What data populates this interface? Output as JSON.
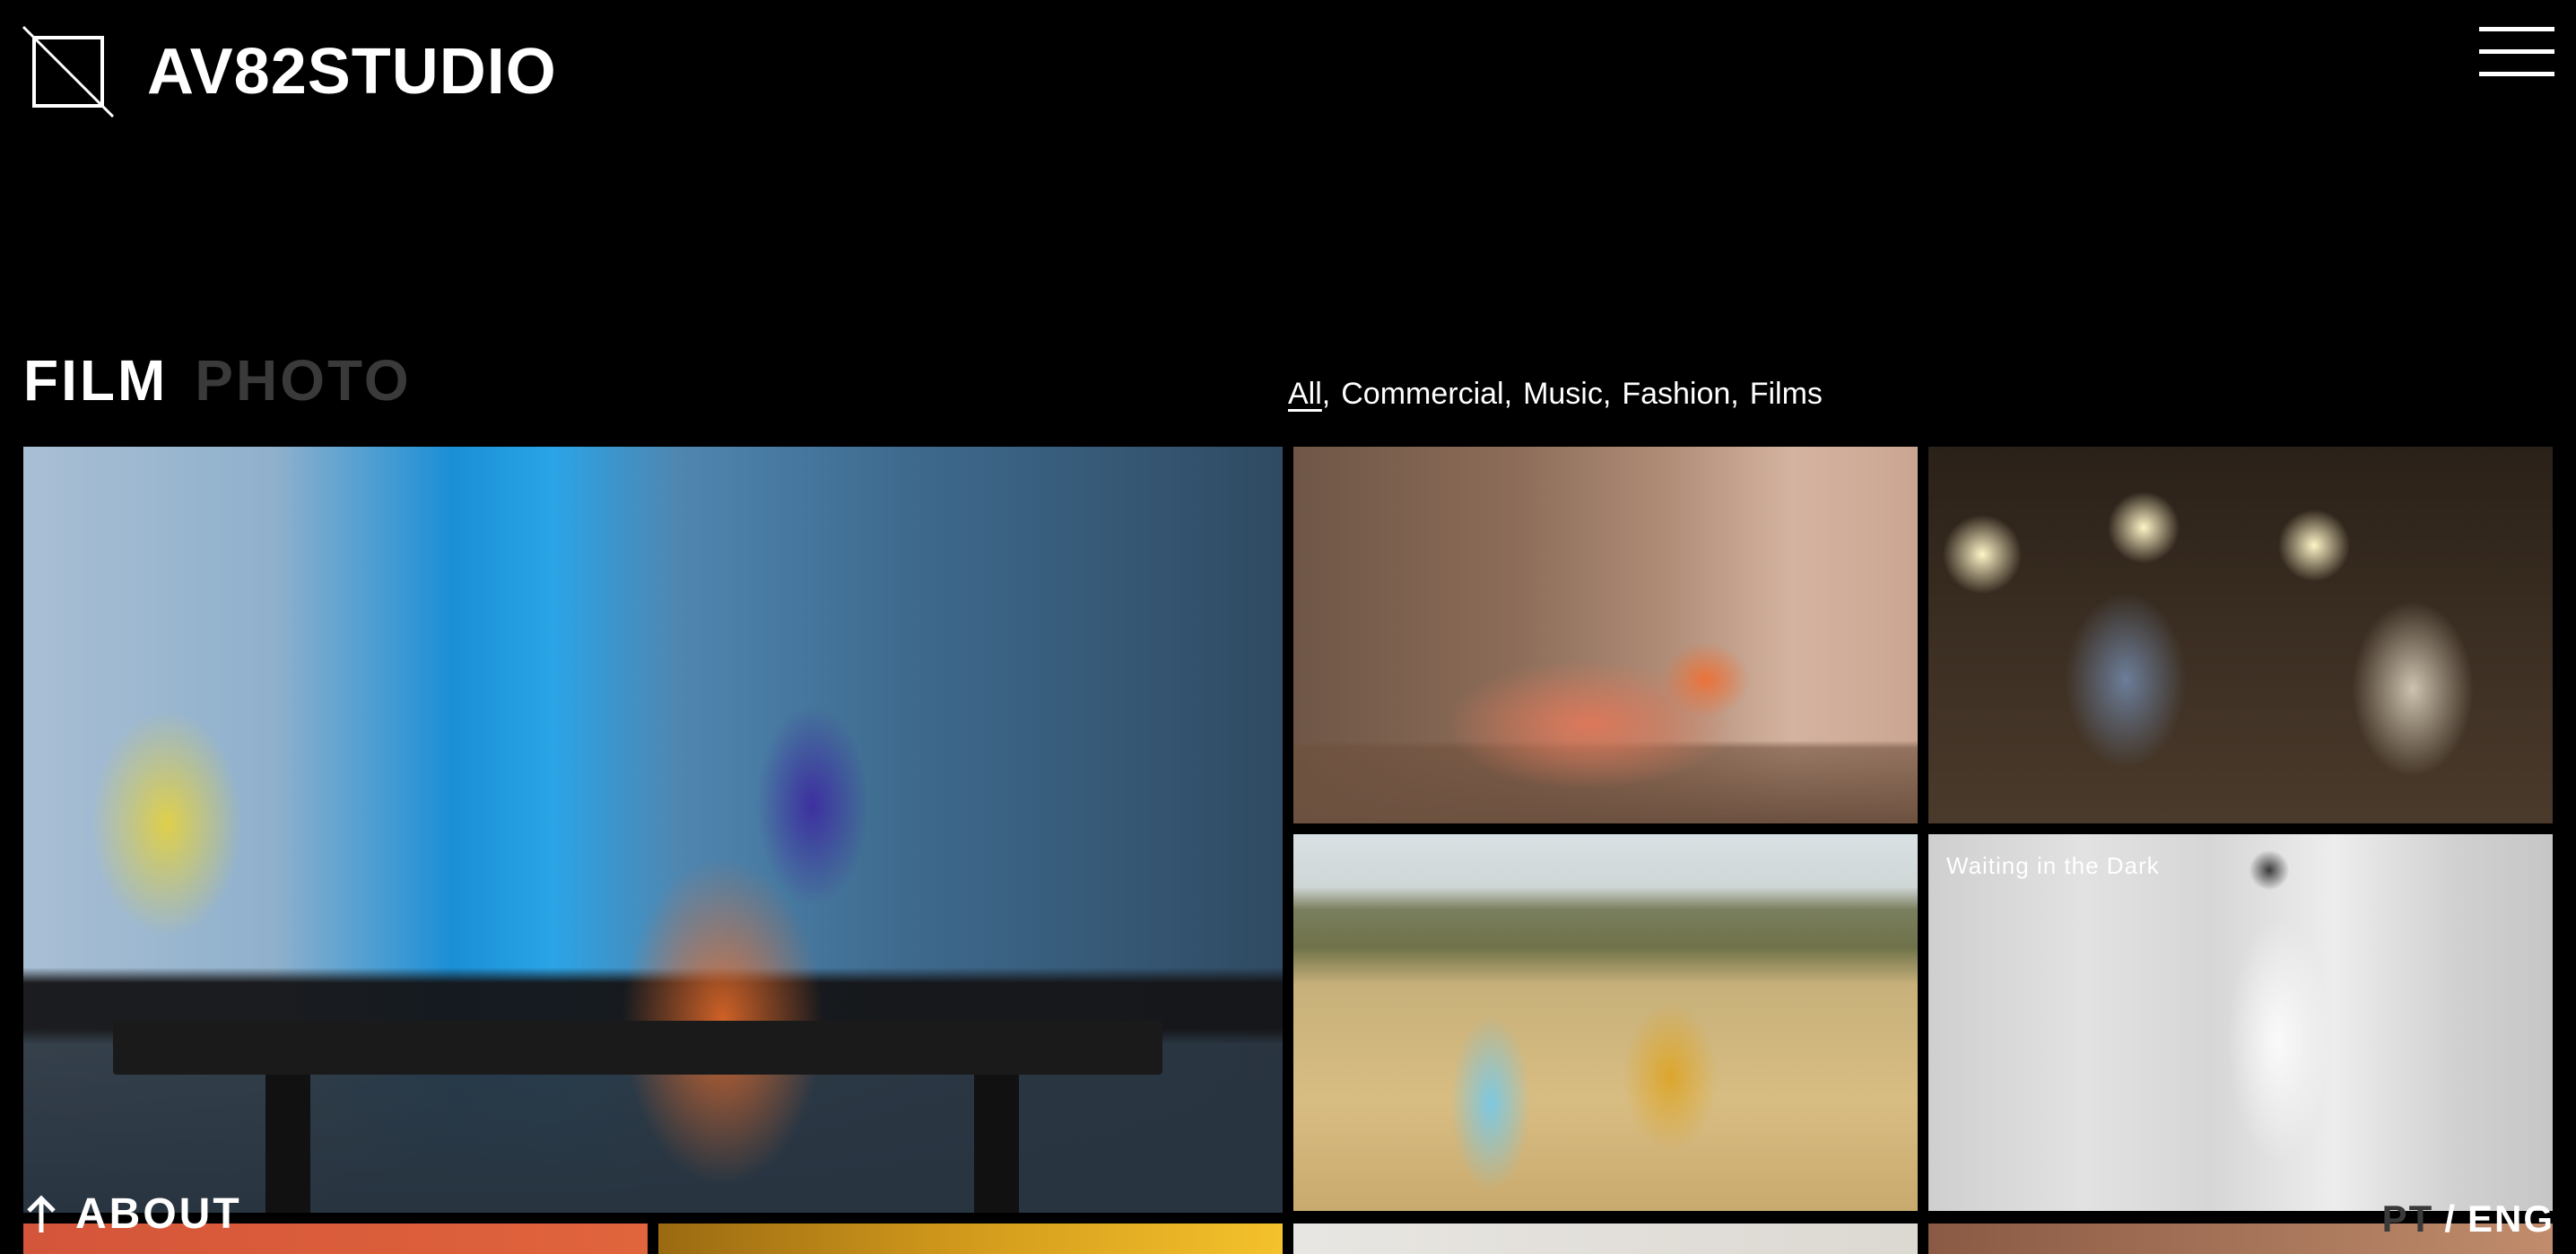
{
  "brand": {
    "name": "AV82STUDIO",
    "logo_icon": "slashed-square-logo"
  },
  "header": {
    "menu_icon": "hamburger-menu-icon"
  },
  "tabs": [
    {
      "label": "FILM",
      "active": true
    },
    {
      "label": "PHOTO",
      "active": false
    }
  ],
  "filters": [
    {
      "label": "All",
      "active": true
    },
    {
      "label": "Commercial",
      "active": false
    },
    {
      "label": "Music",
      "active": false
    },
    {
      "label": "Fashion",
      "active": false
    },
    {
      "label": "Films",
      "active": false
    }
  ],
  "filter_separator": ",",
  "projects": [
    {
      "id": "locker-room",
      "caption": ""
    },
    {
      "id": "dining-table",
      "caption": ""
    },
    {
      "id": "music-session",
      "caption": ""
    },
    {
      "id": "couple-field",
      "caption": ""
    },
    {
      "id": "waiting-in-the-dark",
      "caption": "Waiting in the Dark"
    }
  ],
  "footer": {
    "about_label": "ABOUT",
    "about_icon": "arrow-up-icon",
    "languages": [
      {
        "label": "PT",
        "active": false
      },
      {
        "label": "ENG",
        "active": true
      }
    ],
    "language_separator": "/"
  },
  "colors": {
    "background": "#000000",
    "text": "#ffffff",
    "inactive_text": "#3a3a3a"
  }
}
